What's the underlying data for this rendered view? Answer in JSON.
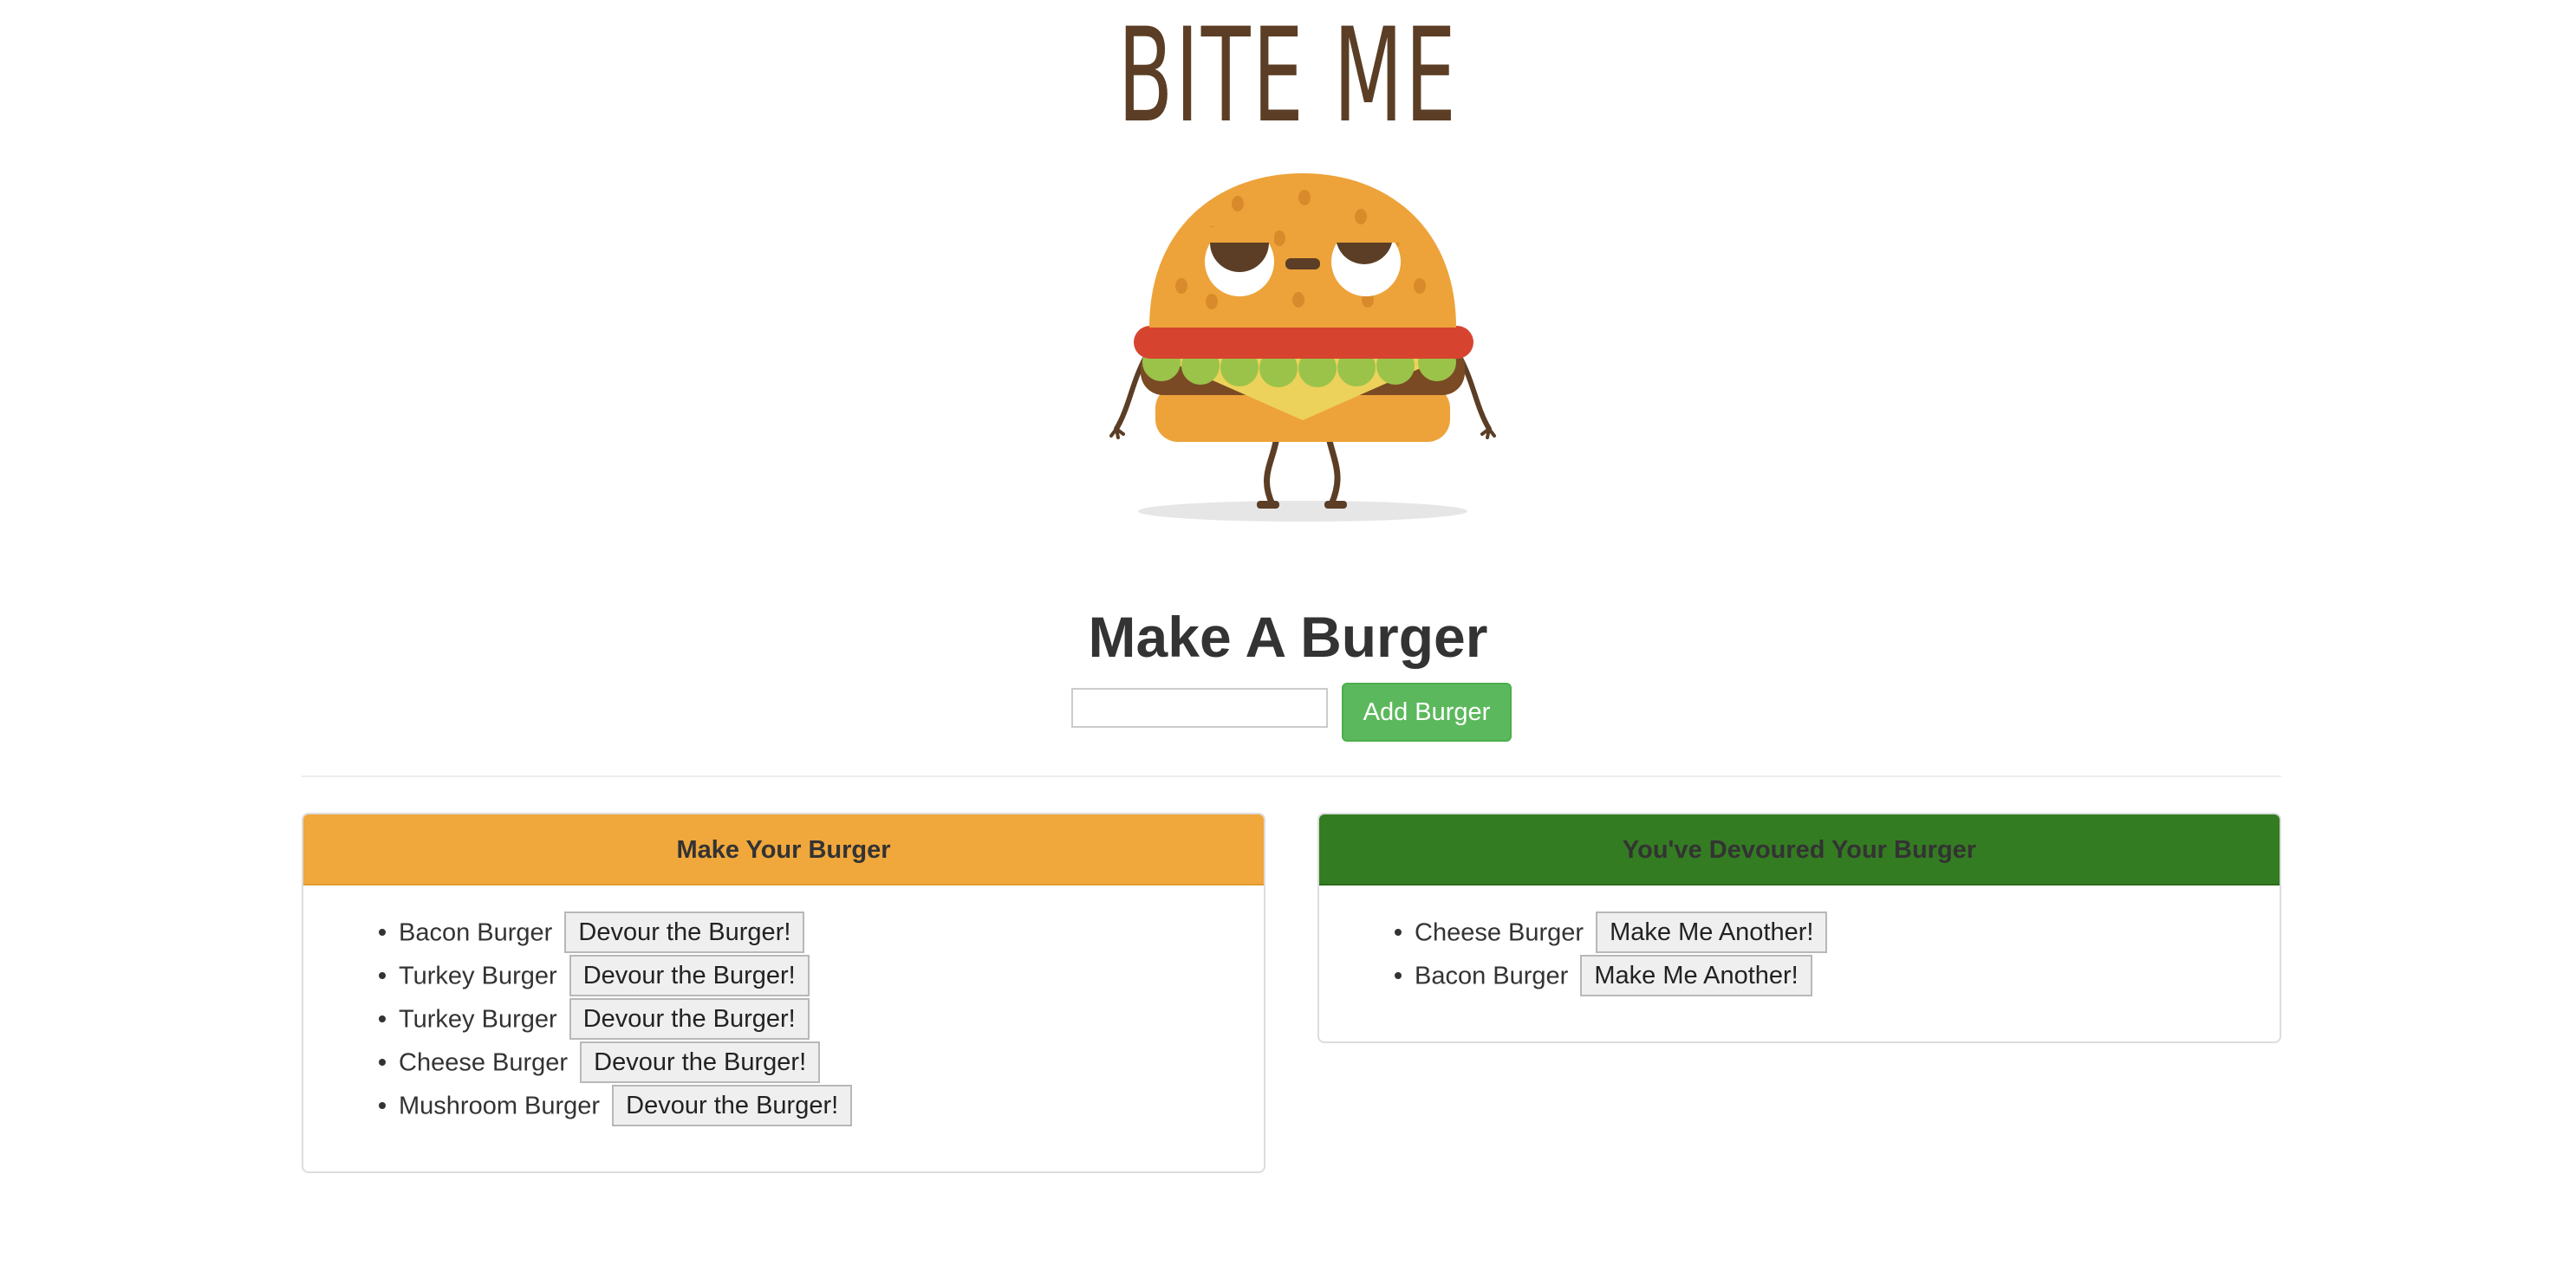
{
  "logo": {
    "title": "BITE ME"
  },
  "colors": {
    "logo_brown": "#5b3e25",
    "bun_orange": "#eda33a",
    "tomato_red": "#d6442f",
    "lettuce_green": "#9bc34a",
    "cheese_yellow": "#ecd25a",
    "add_button_green": "#5cb85c",
    "make_panel_header": "#f0a73b",
    "devoured_panel_header": "#347c22"
  },
  "form": {
    "title": "Make A Burger",
    "input_value": "",
    "input_placeholder": "",
    "add_button_label": "Add Burger"
  },
  "make_panel": {
    "title": "Make Your Burger",
    "items": [
      {
        "name": "Bacon Burger",
        "button": "Devour the Burger!"
      },
      {
        "name": "Turkey Burger",
        "button": "Devour the Burger!"
      },
      {
        "name": "Turkey Burger",
        "button": "Devour the Burger!"
      },
      {
        "name": "Cheese Burger",
        "button": "Devour the Burger!"
      },
      {
        "name": "Mushroom Burger",
        "button": "Devour the Burger!"
      }
    ]
  },
  "devoured_panel": {
    "title": "You've Devoured Your Burger",
    "items": [
      {
        "name": "Cheese Burger",
        "button": "Make Me Another!"
      },
      {
        "name": "Bacon Burger",
        "button": "Make Me Another!"
      }
    ]
  }
}
